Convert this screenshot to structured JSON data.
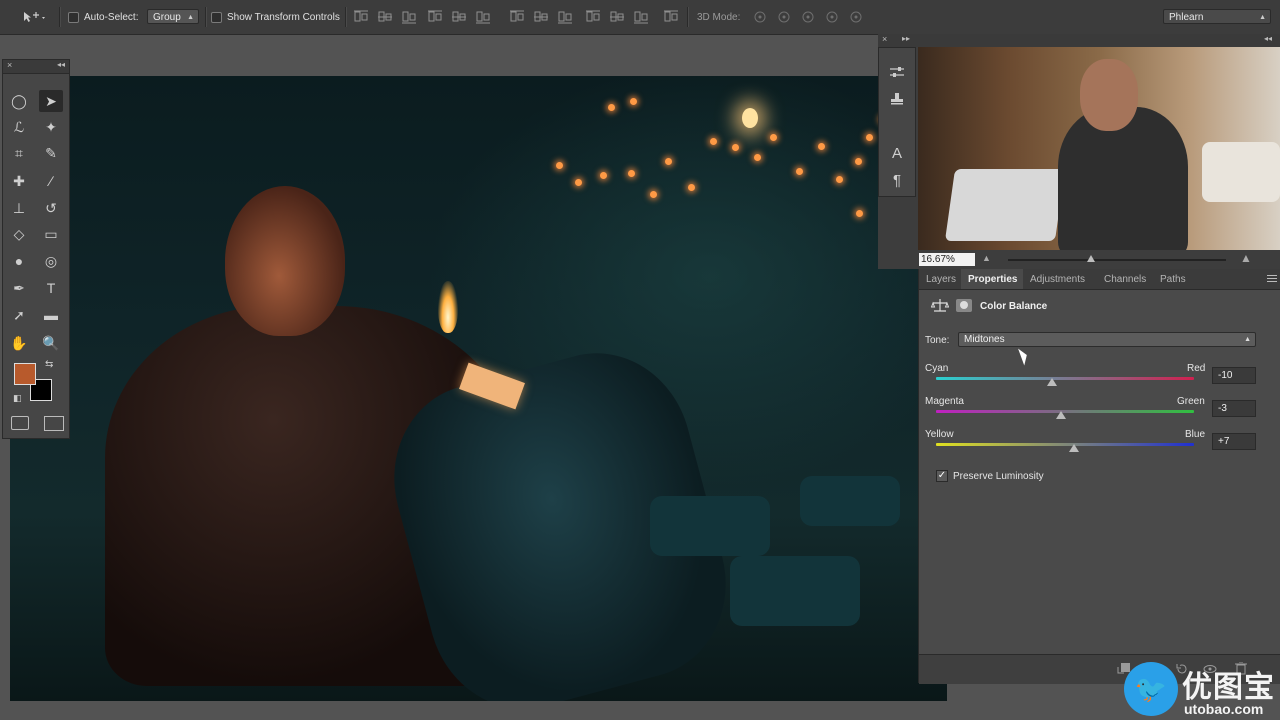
{
  "options_bar": {
    "move_tool_icon": "move-tool-icon",
    "auto_select_label": "Auto-Select:",
    "auto_select_mode": "Group",
    "show_transform_label": "Show Transform Controls",
    "mode_3d_label": "3D Mode:",
    "workspace": "Phlearn"
  },
  "tools": [
    "elliptical-marquee",
    "move",
    "lasso",
    "magic-wand",
    "crop",
    "eyedropper",
    "healing-brush",
    "brush",
    "clone-stamp",
    "history-brush",
    "eraser",
    "gradient",
    "blur",
    "dodge",
    "pen",
    "type",
    "path-selection",
    "rectangle",
    "hand",
    "zoom"
  ],
  "tool_symbols": {
    "type": "T",
    "hand": "✋",
    "zoom": "🔍"
  },
  "colors": {
    "foreground": "#b85a2c",
    "background": "#000000",
    "panel_bg": "#4a4a4a",
    "app_bg": "#535353"
  },
  "navigator": {
    "zoom_value": "16.67%",
    "zoom_fraction": 0.38
  },
  "panel_strip_symbols": {
    "character": "A",
    "paragraph": "¶"
  },
  "tabs": [
    {
      "label": "Layers",
      "active": false
    },
    {
      "label": "Properties",
      "active": true
    },
    {
      "label": "Adjustments",
      "active": false
    },
    {
      "label": "Channels",
      "active": false
    },
    {
      "label": "Paths",
      "active": false
    }
  ],
  "properties": {
    "title": "Color Balance",
    "tone_label": "Tone:",
    "tone_value": "Midtones",
    "sliders": [
      {
        "left": "Cyan",
        "right": "Red",
        "value": "-10",
        "num": -10
      },
      {
        "left": "Magenta",
        "right": "Green",
        "value": "-3",
        "num": -3
      },
      {
        "left": "Yellow",
        "right": "Blue",
        "value": "+7",
        "num": 7
      }
    ],
    "preserve_luminosity_label": "Preserve Luminosity",
    "preserve_luminosity_checked": true,
    "check_mark": "✓"
  },
  "watermark": {
    "bird": "🐦",
    "name": "优图宝",
    "url": "utobao.com"
  }
}
